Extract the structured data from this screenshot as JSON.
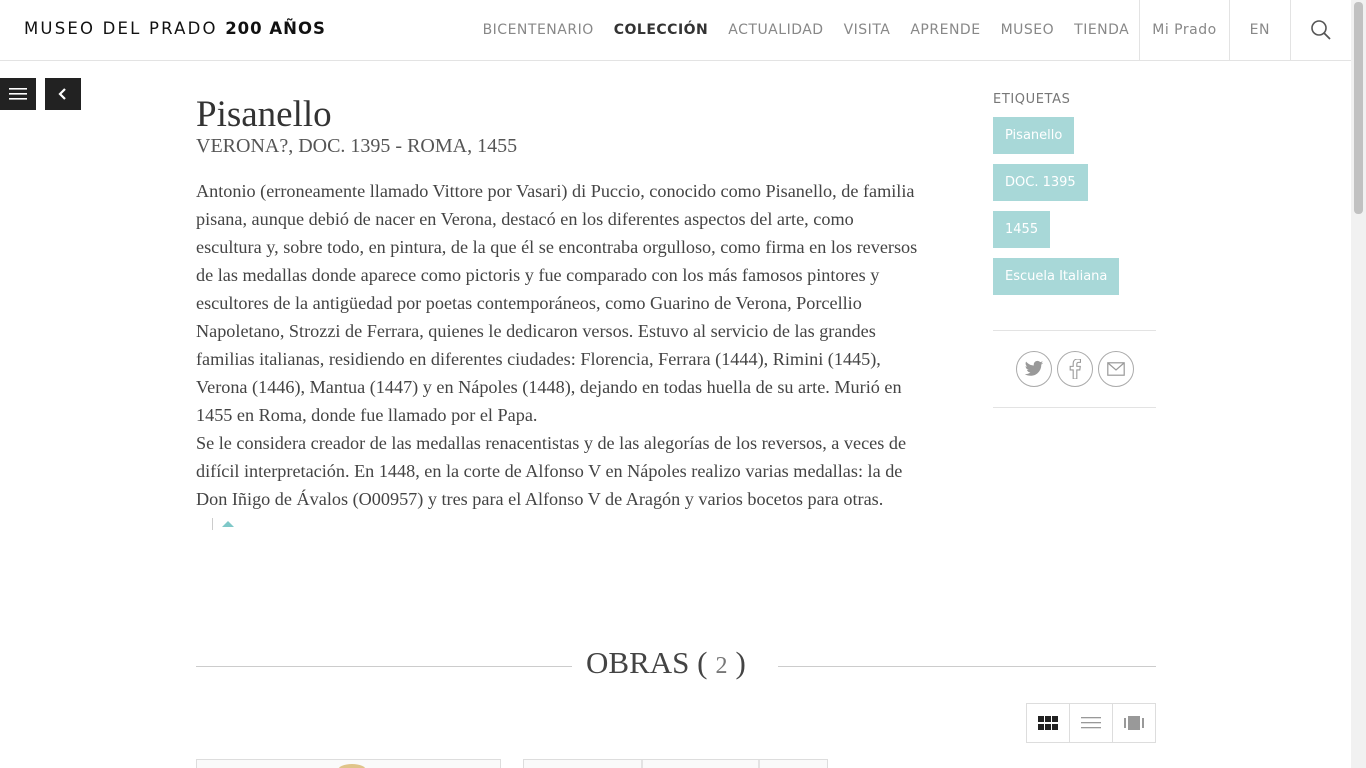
{
  "header": {
    "logo_text": "MUSEO DEL PRADO",
    "logo_bold": "200 AÑOS",
    "nav": [
      {
        "label": "BICENTENARIO"
      },
      {
        "label": "COLECCIÓN"
      },
      {
        "label": "ACTUALIDAD"
      },
      {
        "label": "VISITA"
      },
      {
        "label": "APRENDE"
      },
      {
        "label": "MUSEO"
      },
      {
        "label": "TIENDA"
      }
    ],
    "active_nav": "COLECCIÓN",
    "mi_prado": "Mi Prado",
    "lang": "EN",
    "search_icon": "search-icon"
  },
  "artist": {
    "name": "Pisanello",
    "dates": "VERONA?, DOC. 1395 - ROMA, 1455",
    "bio_p1": "Antonio (erroneamente llamado Vittore por Vasari) di Puccio, conocido como Pisanello, de familia pisana, aunque debió de nacer en Verona, destacó en los diferentes aspectos del arte, como escultura y, sobre todo, en pintura, de la que él se encontraba orgulloso, como firma en los reversos de las medallas donde aparece como pictoris y fue comparado con los más famosos pintores y escultores de la antigüedad por poetas contemporáneos, como Guarino de Verona, Porcellio Napoletano, Strozzi de Ferrara, quienes le dedicaron versos. Estuvo al servicio de las grandes familias italianas, residiendo en diferentes ciudades: Florencia, Ferrara (1444), Rimini (1445), Verona (1446), Mantua (1447) y en Nápoles (1448), dejando en todas huella de su arte. Murió en 1455 en Roma, donde fue llamado por el Papa.",
    "bio_p2": "Se le considera creador de las medallas renacentistas y de las alegorías de los reversos, a veces de difícil interpretación. En 1448, en la corte de Alfonso V en Nápoles realizo varias medallas: la de Don Iñigo de Ávalos (O00957) y tres para el Alfonso V de Aragón y varios bocetos para otras."
  },
  "tags": {
    "title": "ETIQUETAS",
    "items": [
      "Pisanello",
      "DOC. 1395",
      "1455",
      "Escuela Italiana"
    ]
  },
  "share": {
    "icons": [
      "twitter-icon",
      "facebook-icon",
      "email-icon"
    ]
  },
  "works": {
    "heading": "OBRAS",
    "open_paren": "(",
    "count": "2",
    "close_paren": ")",
    "views": [
      "grid-view-icon",
      "list-view-icon",
      "slide-view-icon"
    ]
  },
  "colors": {
    "tag_bg": "#a8d8d8",
    "accent": "#7ec8c8",
    "dark_button": "#222222"
  }
}
